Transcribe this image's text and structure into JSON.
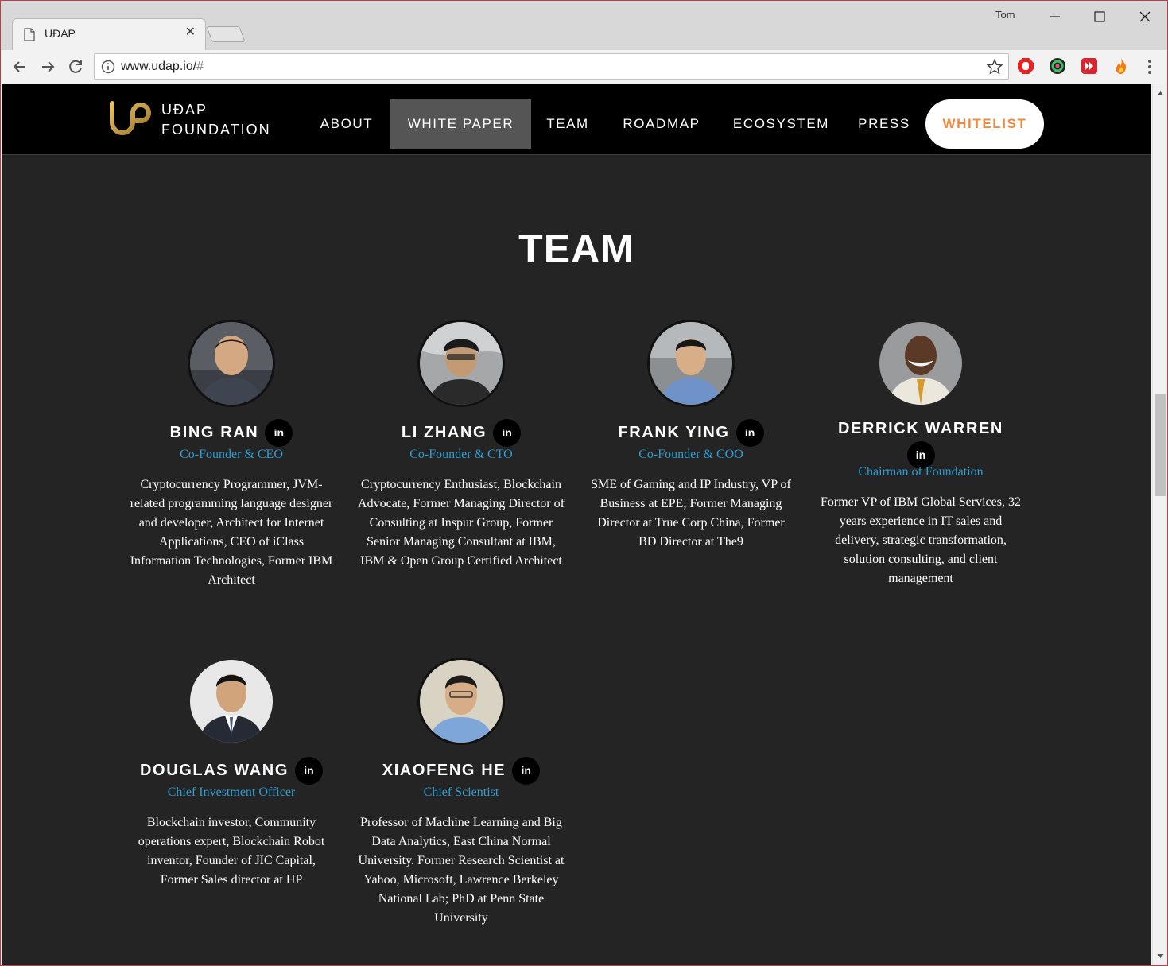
{
  "browser": {
    "tab_title": "UĐAP",
    "user": "Tom",
    "url_main": "www.udap.io/",
    "url_suffix": "#"
  },
  "site": {
    "brand_line1": "UĐAP",
    "brand_line2": "FOUNDATION",
    "nav": [
      {
        "label": "ABOUT"
      },
      {
        "label": "WHITE PAPER"
      },
      {
        "label": "TEAM"
      },
      {
        "label": "ROADMAP"
      },
      {
        "label": "ECOSYSTEM"
      },
      {
        "label": "PRESS"
      }
    ],
    "nav_active": "WHITE PAPER",
    "cta": "WHITELIST",
    "colors": {
      "accent_orange": "#f08a3c",
      "role_blue": "#2d9dd2",
      "background": "#242424",
      "logo_gold": "#c9a24a"
    }
  },
  "team": {
    "title": "TEAM",
    "linkedin_label": "in",
    "members": [
      {
        "name": "BING RAN",
        "role": "Co-Founder & CEO",
        "bio": "Cryptocurrency Programmer, JVM-related programming language designer and developer, Architect for Internet Applications, CEO of iClass Information Technologies, Former IBM Architect"
      },
      {
        "name": "LI ZHANG",
        "role": "Co-Founder & CTO",
        "bio": "Cryptocurrency Enthusiast, Blockchain Advocate, Former Managing Director of Consulting at Inspur Group, Former Senior Managing Consultant at IBM, IBM & Open Group Certified Architect"
      },
      {
        "name": "FRANK YING",
        "role": "Co-Founder & COO",
        "bio": "SME of Gaming and IP Industry, VP of Business at EPE, Former Managing Director at True Corp China, Former BD Director at The9"
      },
      {
        "name": "DERRICK WARREN",
        "role": "Chairman of Foundation",
        "bio": "Former VP of IBM Global Services, 32 years experience in IT sales and delivery, strategic transformation, solution consulting, and client management"
      },
      {
        "name": "DOUGLAS WANG",
        "role": "Chief Investment Officer",
        "bio": "Blockchain investor, Community operations expert, Blockchain Robot inventor, Founder of JIC Capital, Former Sales director at HP"
      },
      {
        "name": "XIAOFENG HE",
        "role": "Chief Scientist",
        "bio": "Professor of Machine Learning and Big Data Analytics, East China Normal University. Former Research Scientist at Yahoo, Microsoft, Lawrence Berkeley National Lab; PhD at Penn State University"
      }
    ]
  }
}
